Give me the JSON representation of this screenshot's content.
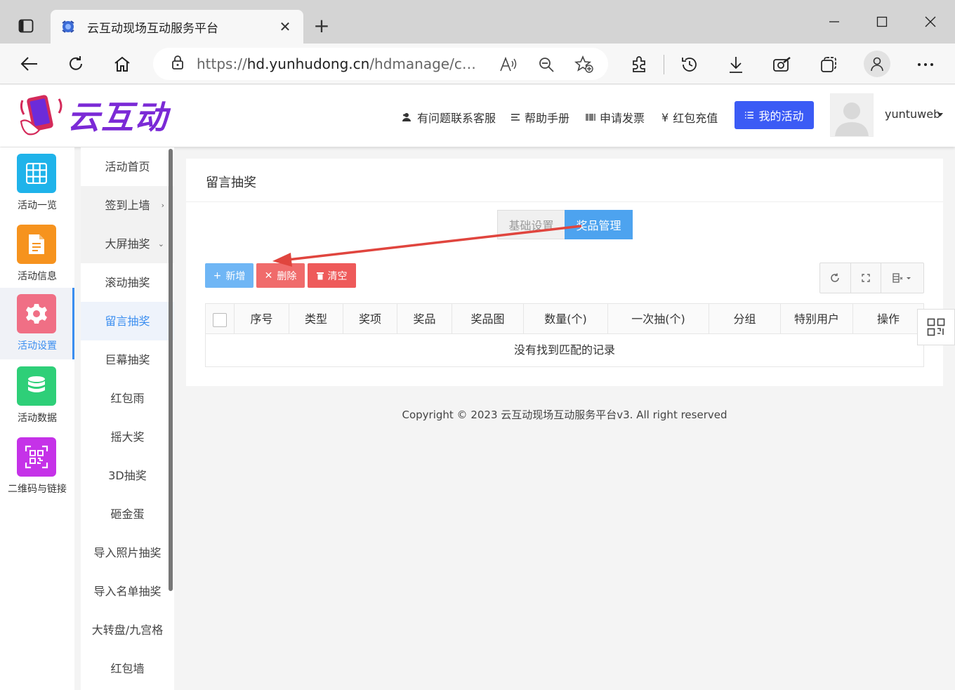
{
  "browser": {
    "tab_title": "云互动现场互动服务平台",
    "url_prefix": "https://",
    "url_host": "hd.yunhudong.cn",
    "url_path": "/hdmanage/confi..."
  },
  "header": {
    "logo_text": "云互动",
    "nav": {
      "support": "有问题联系客服",
      "help": "帮助手册",
      "invoice": "申请发票",
      "recharge": "红包充值"
    },
    "my_activity": "我的活动",
    "username": "yuntuweb"
  },
  "icon_sidebar": [
    {
      "label": "活动一览",
      "icon": "grid-icon",
      "color": "#1fb3ea"
    },
    {
      "label": "活动信息",
      "icon": "document-icon",
      "color": "#f6931e"
    },
    {
      "label": "活动设置",
      "icon": "gear-icon",
      "color": "#f06f85"
    },
    {
      "label": "活动数据",
      "icon": "database-icon",
      "color": "#2ecf78"
    },
    {
      "label": "二维码与链接",
      "icon": "qrcode-icon",
      "color": "#c532e8"
    }
  ],
  "sub_menu": [
    {
      "label": "活动首页"
    },
    {
      "label": "签到上墙"
    },
    {
      "label": "大屏抽奖"
    },
    {
      "label": "滚动抽奖"
    },
    {
      "label": "留言抽奖"
    },
    {
      "label": "巨幕抽奖"
    },
    {
      "label": "红包雨"
    },
    {
      "label": "摇大奖"
    },
    {
      "label": "3D抽奖"
    },
    {
      "label": "砸金蛋"
    },
    {
      "label": "导入照片抽奖"
    },
    {
      "label": "导入名单抽奖"
    },
    {
      "label": "大转盘/九宫格"
    },
    {
      "label": "红包墙"
    }
  ],
  "content": {
    "title": "留言抽奖",
    "tabs": {
      "basic": "基础设置",
      "prize": "奖品管理"
    },
    "buttons": {
      "add": "新增",
      "delete": "删除",
      "clear": "清空"
    },
    "columns": [
      "序号",
      "类型",
      "奖项",
      "奖品",
      "奖品图",
      "数量(个)",
      "一次抽(个)",
      "分组",
      "特别用户",
      "操作"
    ],
    "empty_text": "没有找到匹配的记录"
  },
  "footer": {
    "copyright": "Copyright © 2023 云互动现场互动服务平台v3. All right reserved"
  },
  "colors": {
    "accent": "#3b5bf5",
    "active_blue": "#3b8ef0",
    "prize_tab": "#4da3ef",
    "danger": "#ee5a5a",
    "annotation_arrow": "#e0453e"
  }
}
